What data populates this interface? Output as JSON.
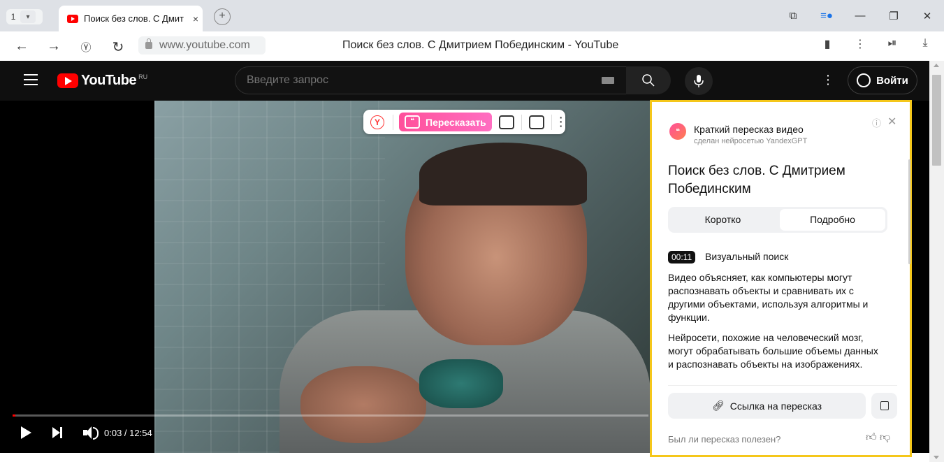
{
  "browser": {
    "tab_count": "1",
    "tab_title": "Поиск без слов. С Дмит",
    "tab_close": "×",
    "new_tab": "+",
    "address_url": "www.youtube.com",
    "page_title": "Поиск без слов. С Дмитрием Побединским - YouTube"
  },
  "youtube": {
    "logo_text": "YouTube",
    "region": "RU",
    "search_placeholder": "Введите запрос",
    "signin_label": "Войти"
  },
  "player": {
    "time": "0:03 / 12:54",
    "progress_fraction": 0.004
  },
  "overlay_toolbar": {
    "retell_label": "Пересказать",
    "yandex_letter": "Y"
  },
  "panel": {
    "header": "Краткий пересказ видео",
    "subheader": "сделан нейросетью YandexGPT",
    "title": "Поиск без слов. С Дмитрием Побединским",
    "tabs": [
      {
        "label": "Коротко",
        "active": false
      },
      {
        "label": "Подробно",
        "active": true
      }
    ],
    "section": {
      "timestamp": "00:11",
      "title": "Визуальный поиск",
      "paragraphs": [
        "Видео объясняет, как компьютеры могут распознавать объекты и сравнивать их с другими объектами, используя алгоритмы и функции.",
        "Нейросети, похожие на человеческий мозг, могут обрабатывать большие объемы данных и распознавать объекты на изображениях."
      ]
    },
    "link_button": "Ссылка на пересказ",
    "feedback_question": "Был ли пересказ полезен?"
  },
  "colors": {
    "highlight_border": "#f5c71a",
    "youtube_red": "#ff0000",
    "retell_pink": "#ff4f9a"
  }
}
